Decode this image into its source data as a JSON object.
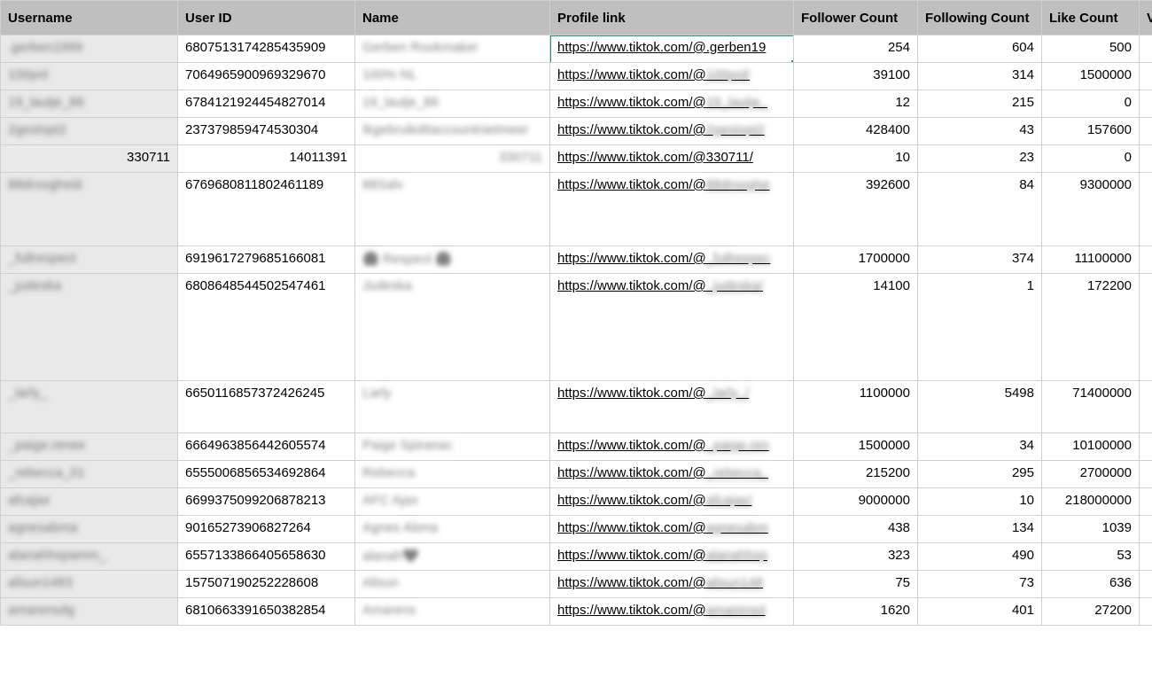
{
  "headers": {
    "username": "Username",
    "user_id": "User ID",
    "name": "Name",
    "profile_link": "Profile link",
    "follower_count": "Follower Count",
    "following_count": "Following Count",
    "like_count": "Like Count",
    "v": "V"
  },
  "rows": [
    {
      "username": ".gerben1999",
      "user_id": "6807513174285435909",
      "name": "Gerben Rookmaker",
      "profile_link": "https://www.tiktok.com/@.gerben19",
      "followers": "254",
      "following": "604",
      "likes": "500",
      "username_blur": true,
      "name_blur": true
    },
    {
      "username": "100pnl",
      "user_id": "7064965900969329670",
      "name": "100% NL",
      "profile_link": "https://www.tiktok.com/@100pnl/",
      "followers": "39100",
      "following": "314",
      "likes": "1500000",
      "username_blur": true,
      "name_blur": true
    },
    {
      "username": "19_lautje_86",
      "user_id": "6784121924454827014",
      "name": "19_lautje_86",
      "profile_link": "https://www.tiktok.com/@19_lautje_",
      "followers": "12",
      "following": "215",
      "likes": "0",
      "username_blur": true,
      "name_blur": true
    },
    {
      "username": "2gestopt2",
      "user_id": "237379859474530304",
      "name": "Ikgebruikditaccountnietmeer",
      "profile_link": "https://www.tiktok.com/@2gestopt2",
      "followers": "428400",
      "following": "43",
      "likes": "157600",
      "username_blur": true,
      "name_blur": true
    },
    {
      "username": "330711",
      "user_id": "14011391",
      "name": "330711",
      "profile_link": "https://www.tiktok.com/@330711/",
      "followers": "10",
      "following": "23",
      "likes": "0",
      "username_right_align": true,
      "userid_right_align": true,
      "name_right_align": true,
      "name_blur": true
    },
    {
      "username": "88droogheid",
      "user_id": "6769680811802461189",
      "name": "88Salv",
      "profile_link": "https://www.tiktok.com/@88drooghe",
      "followers": "392600",
      "following": "84",
      "likes": "9300000",
      "row_class": "h2",
      "username_blur": true,
      "name_blur": true
    },
    {
      "username": "_fullrespect",
      "user_id": "6919617279685166081",
      "name": "😱 Respect 😱",
      "profile_link": "https://www.tiktok.com/@_fullrespec",
      "followers": "1700000",
      "following": "374",
      "likes": "11100000",
      "username_blur": true,
      "name_blur": true
    },
    {
      "username": "_judeska",
      "user_id": "6808648544502547461",
      "name": "Judeska",
      "profile_link": "https://www.tiktok.com/@_judeska/",
      "followers": "14100",
      "following": "1",
      "likes": "172200",
      "row_class": "h3",
      "username_blur": true,
      "name_blur": true
    },
    {
      "username": "_larly_",
      "user_id": "6650116857372426245",
      "name": "Larly",
      "profile_link": "https://www.tiktok.com/@_larly_/",
      "followers": "1100000",
      "following": "5498",
      "likes": "71400000",
      "row_class": "h4",
      "username_blur": true,
      "name_blur": true
    },
    {
      "username": "_paige.renee",
      "user_id": "6664963856442605574",
      "name": "Paige Spiranac",
      "profile_link": "https://www.tiktok.com/@_paige.ren",
      "followers": "1500000",
      "following": "34",
      "likes": "10100000",
      "username_blur": true,
      "name_blur": true
    },
    {
      "username": "_rebecca_01",
      "user_id": "6555006856534692864",
      "name": "Rebecca",
      "profile_link": "https://www.tiktok.com/@_rebecca_",
      "followers": "215200",
      "following": "295",
      "likes": "2700000",
      "username_blur": true,
      "name_blur": true
    },
    {
      "username": "afcajax",
      "user_id": "6699375099206878213",
      "name": "AFC Ajax",
      "profile_link": "https://www.tiktok.com/@afcajax/",
      "followers": "9000000",
      "following": "10",
      "likes": "218000000",
      "username_blur": true,
      "name_blur": true
    },
    {
      "username": "agnesabma",
      "user_id": "90165273906827264",
      "name": "Agnes Abma",
      "profile_link": "https://www.tiktok.com/@agnesabm",
      "followers": "438",
      "following": "134",
      "likes": "1039",
      "username_blur": true,
      "name_blur": true
    },
    {
      "username": "alanahhspamm_",
      "user_id": "6557133866405658630",
      "name": "alanah❤️",
      "profile_link": "https://www.tiktok.com/@alanahhsp",
      "followers": "323",
      "following": "490",
      "likes": "53",
      "username_blur": true,
      "name_blur": true
    },
    {
      "username": "alisun1483",
      "user_id": "157507190252228608",
      "name": "Alisun",
      "profile_link": "https://www.tiktok.com/@alisun148",
      "followers": "75",
      "following": "73",
      "likes": "636",
      "username_blur": true,
      "name_blur": true
    },
    {
      "username": "amarensdg",
      "user_id": "6810663391650382854",
      "name": "Amarens",
      "profile_link": "https://www.tiktok.com/@amarensd",
      "followers": "1620",
      "following": "401",
      "likes": "27200",
      "username_blur": true,
      "name_blur": true
    }
  ],
  "selected_cell": {
    "row": 0,
    "col": "profile_link"
  }
}
